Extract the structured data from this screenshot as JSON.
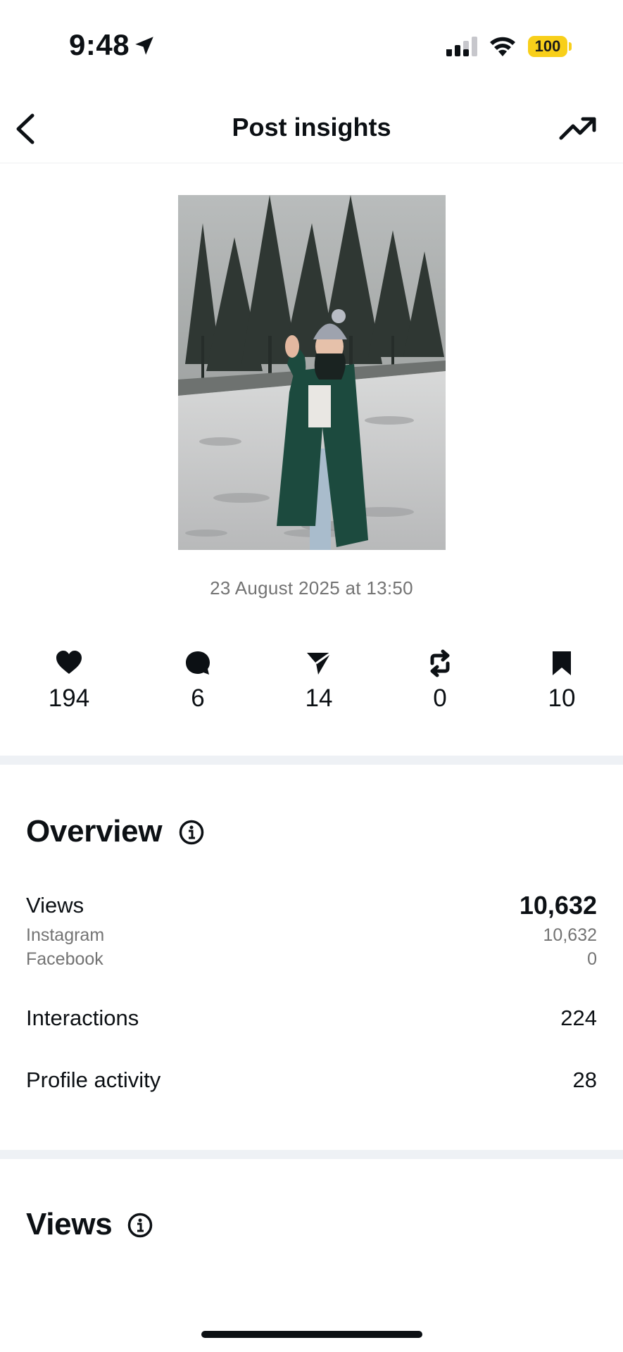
{
  "status_bar": {
    "time": "9:48",
    "battery": "100",
    "battery_color": "#f8cf1a"
  },
  "header": {
    "title": "Post insights",
    "back_icon": "chevron-left-icon",
    "trend_icon": "trending-up-icon"
  },
  "post": {
    "date": "23 August 2025 at 13:50"
  },
  "stats": [
    {
      "icon": "heart-icon",
      "value": "194"
    },
    {
      "icon": "comment-icon",
      "value": "6"
    },
    {
      "icon": "share-icon",
      "value": "14"
    },
    {
      "icon": "repost-icon",
      "value": "0"
    },
    {
      "icon": "bookmark-icon",
      "value": "10"
    }
  ],
  "overview": {
    "title": "Overview",
    "views_label": "Views",
    "views_value": "10,632",
    "instagram_label": "Instagram",
    "instagram_value": "10,632",
    "facebook_label": "Facebook",
    "facebook_value": "0",
    "interactions_label": "Interactions",
    "interactions_value": "224",
    "profile_activity_label": "Profile activity",
    "profile_activity_value": "28"
  },
  "views_section": {
    "title": "Views"
  }
}
